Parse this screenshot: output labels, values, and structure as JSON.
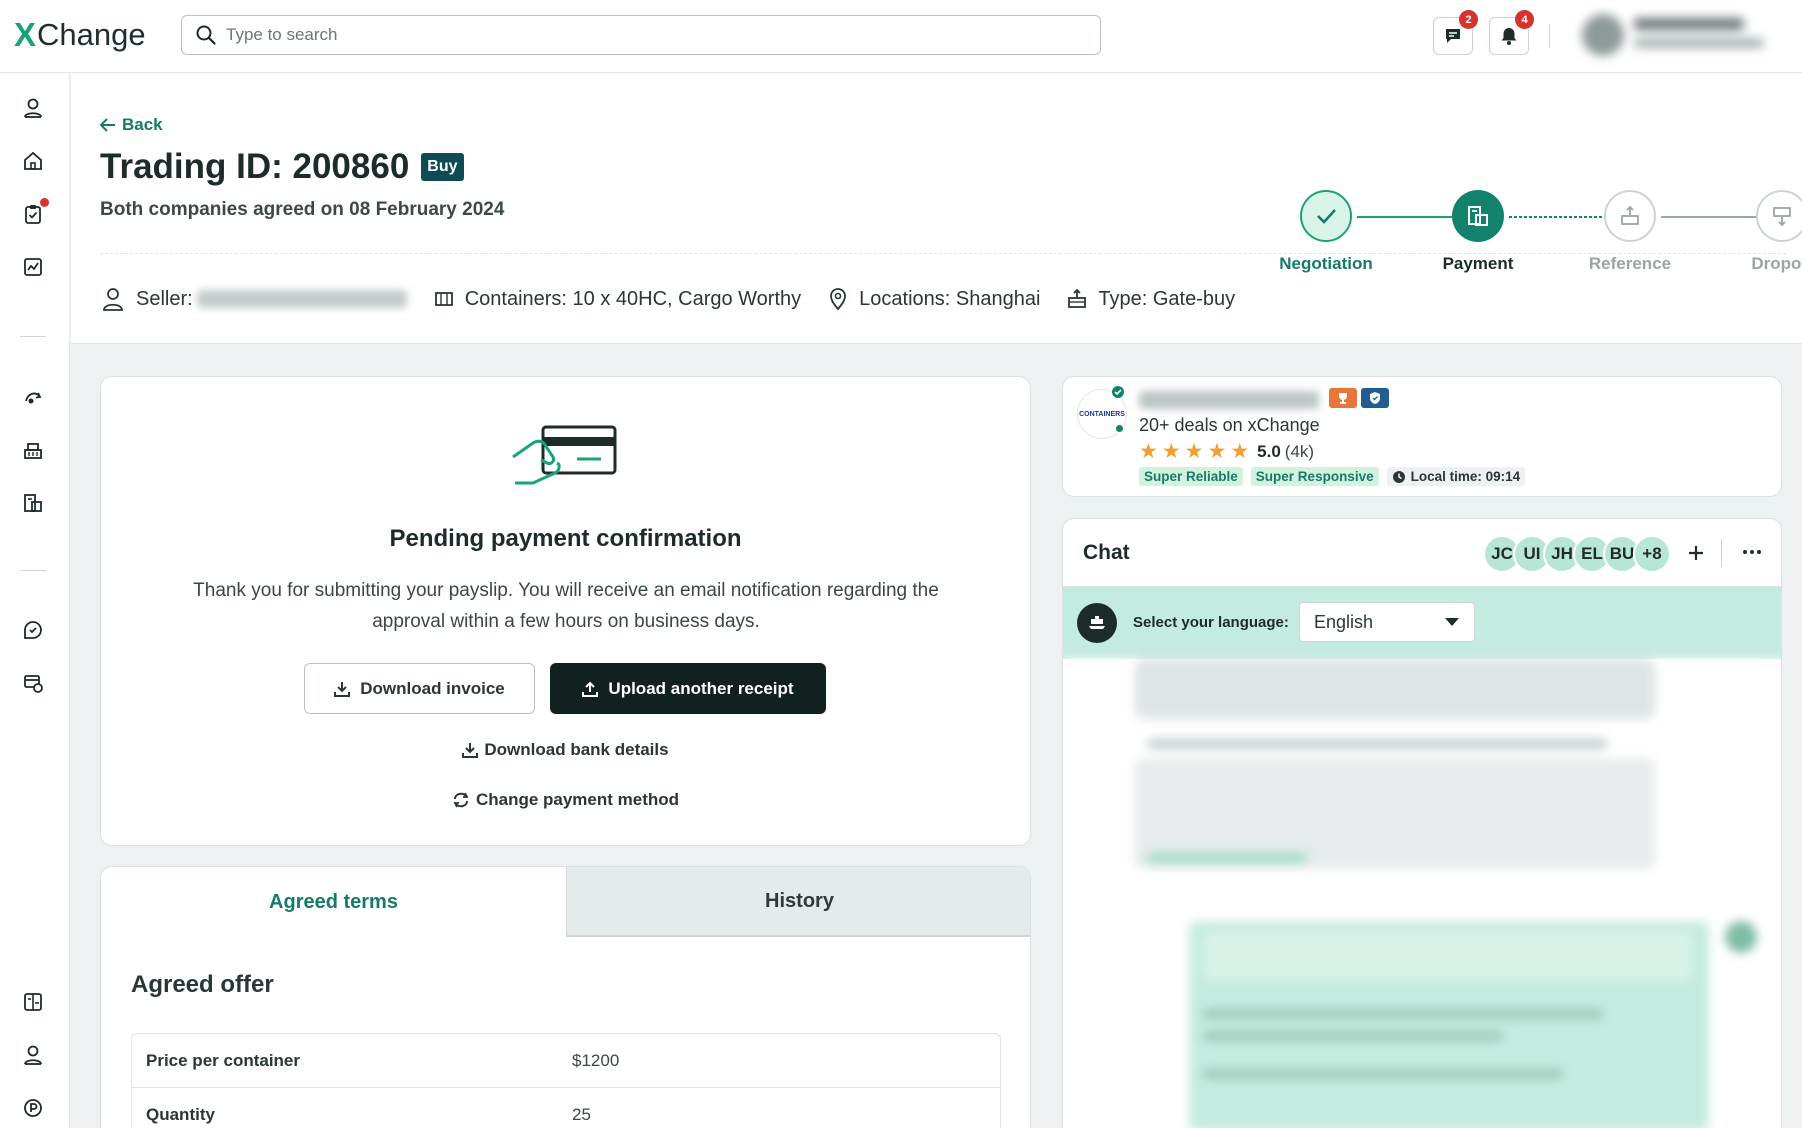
{
  "app": {
    "logo_x": "X",
    "logo_text": "Change"
  },
  "search": {
    "placeholder": "Type to search"
  },
  "topbar": {
    "messages_count": "2",
    "notifications_count": "4"
  },
  "page": {
    "back_label": "Back",
    "title": "Trading ID: 200860",
    "trade_badge": "Buy",
    "subtitle": "Both companies agreed on 08 February 2024"
  },
  "stepper": {
    "steps": [
      {
        "label": "Negotiation",
        "state": "done"
      },
      {
        "label": "Payment",
        "state": "active"
      },
      {
        "label": "Reference",
        "state": "todo"
      },
      {
        "label": "Dropoff",
        "state": "todo"
      }
    ]
  },
  "meta": {
    "seller_label": "Seller:",
    "containers": "Containers: 10 x 40HC, Cargo Worthy",
    "locations": "Locations: Shanghai",
    "type": "Type: Gate-buy"
  },
  "payment": {
    "title": "Pending payment confirmation",
    "text": "Thank you for submitting your payslip. You will receive an email notification regarding the approval within a few hours on business days.",
    "download_invoice": "Download invoice",
    "upload_receipt": "Upload another receipt",
    "download_bank": "Download bank details",
    "change_method": "Change payment method"
  },
  "terms": {
    "tabs": [
      "Agreed terms",
      "History"
    ],
    "offer_title": "Agreed offer",
    "rows": [
      {
        "key": "Price per container",
        "value": "$1200"
      },
      {
        "key": "Quantity",
        "value": "25"
      }
    ]
  },
  "seller_card": {
    "logo_text": "CONTAINERS",
    "deals": "20+ deals on xChange",
    "rating": "5.0",
    "rating_count": "(4k)",
    "stars": 5,
    "tags": [
      "Super Reliable",
      "Super Responsive"
    ],
    "local_time": "Local time: 09:14"
  },
  "chat": {
    "title": "Chat",
    "avatars": [
      "JC",
      "UI",
      "JH",
      "EL",
      "BU",
      "+8"
    ],
    "language_label": "Select your language:",
    "language_value": "English"
  },
  "colors": {
    "accent": "#12826c",
    "accent_text": "#177a66",
    "dark": "#11211f",
    "badge": "#d6322e",
    "chat_bar": "#c4ebdf"
  }
}
